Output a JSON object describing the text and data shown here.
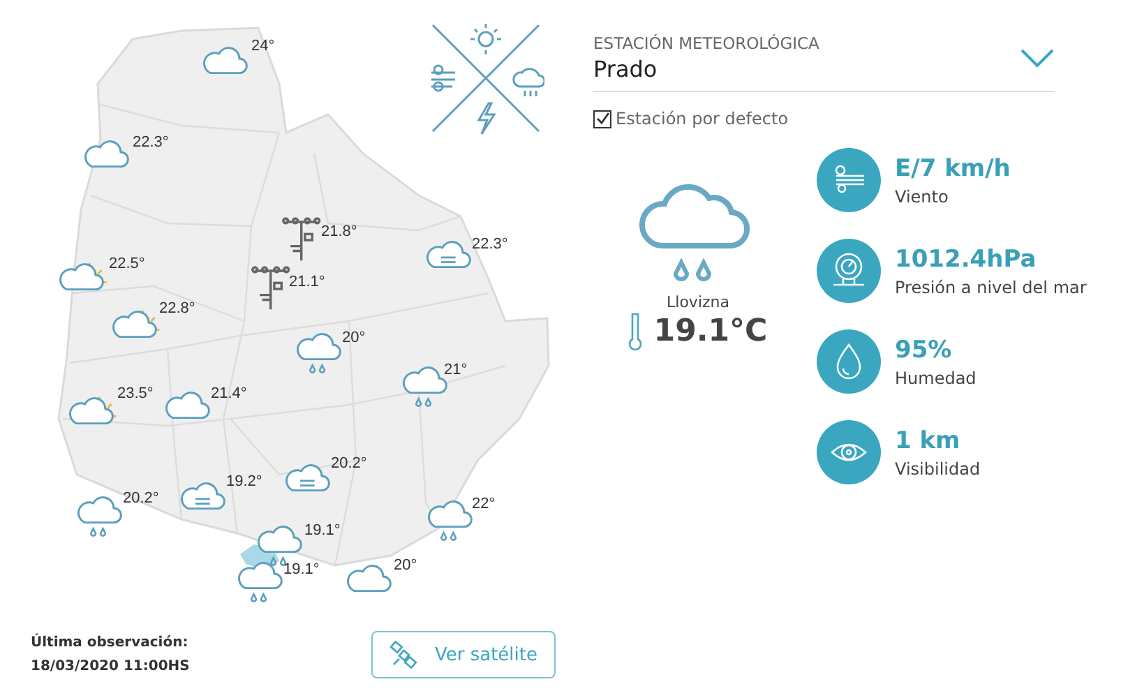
{
  "map": {
    "stations": [
      {
        "kind": "cloud",
        "temp": "24°"
      },
      {
        "kind": "cloud",
        "temp": "22.3°"
      },
      {
        "kind": "mast",
        "temp": "21.8°"
      },
      {
        "kind": "fog",
        "temp": "22.3°"
      },
      {
        "kind": "sun",
        "temp": "22.5°"
      },
      {
        "kind": "mast",
        "temp": "21.1°"
      },
      {
        "kind": "sun",
        "temp": "22.8°"
      },
      {
        "kind": "rain",
        "temp": "20°"
      },
      {
        "kind": "rain",
        "temp": "21°"
      },
      {
        "kind": "sun",
        "temp": "23.5°"
      },
      {
        "kind": "cloud",
        "temp": "21.4°"
      },
      {
        "kind": "fog",
        "temp": "20.2°"
      },
      {
        "kind": "fog",
        "temp": "19.2°"
      },
      {
        "kind": "rain",
        "temp": "20.2°"
      },
      {
        "kind": "rain",
        "temp": "22°"
      },
      {
        "kind": "rain",
        "temp": "19.1°"
      },
      {
        "kind": "rain",
        "temp": "19.1°"
      },
      {
        "kind": "cloud",
        "temp": "20°"
      }
    ]
  },
  "last_observation": {
    "label": "Última observación:",
    "datetime": "18/03/2020 11:00HS"
  },
  "satellite_button": "Ver satélite",
  "station_select": {
    "label": "ESTACIÓN METEOROLÓGICA",
    "value": "Prado"
  },
  "default_station": {
    "label": "Estación por defecto",
    "checked": true
  },
  "current": {
    "kind": "rain",
    "condition": "Llovizna",
    "temperature": "19.1°C"
  },
  "metrics": [
    {
      "kind": "wind",
      "value": "E/7 km/h",
      "label": "Viento"
    },
    {
      "kind": "pressure",
      "value": "1012.4hPa",
      "label": "Presión a nivel del mar"
    },
    {
      "kind": "humidity",
      "value": "95%",
      "label": "Humedad"
    },
    {
      "kind": "visibility",
      "value": "1 km",
      "label": "Visibilidad"
    }
  ]
}
